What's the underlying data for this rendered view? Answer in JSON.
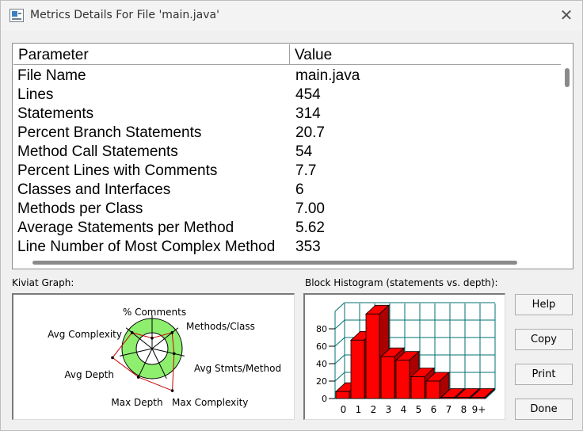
{
  "window": {
    "title": "Metrics Details For File 'main.java'",
    "close_glyph": "✕"
  },
  "table": {
    "headers": [
      "Parameter",
      "Value"
    ],
    "rows": [
      {
        "param": "File Name",
        "value": "main.java"
      },
      {
        "param": "Lines",
        "value": "454"
      },
      {
        "param": "Statements",
        "value": "314"
      },
      {
        "param": "Percent Branch Statements",
        "value": "20.7"
      },
      {
        "param": "Method Call Statements",
        "value": "54"
      },
      {
        "param": "Percent Lines with Comments",
        "value": "7.7"
      },
      {
        "param": "Classes and Interfaces",
        "value": "6"
      },
      {
        "param": "Methods per Class",
        "value": "7.00"
      },
      {
        "param": "Average Statements per Method",
        "value": "5.62"
      },
      {
        "param": "Line Number of Most Complex Method",
        "value": "353"
      }
    ]
  },
  "kiviat": {
    "label": "Kiviat Graph:",
    "axes": [
      "% Comments",
      "Methods/Class",
      "Avg Stmts/Method",
      "Max Complexity",
      "Max Depth",
      "Avg Depth",
      "Avg Complexity"
    ],
    "colors": {
      "band": "#8eee6e",
      "center": "#ffffff",
      "outline": "#000000",
      "polygon": "#cc0000"
    }
  },
  "histogram": {
    "label": "Block Histogram (statements vs. depth):",
    "colors": {
      "bar": "#ff0000",
      "bar_side": "#aa0000",
      "grid": "#007070"
    }
  },
  "chart_data": {
    "type": "bar",
    "categories": [
      "0",
      "1",
      "2",
      "3",
      "4",
      "5",
      "6",
      "7",
      "8",
      "9+"
    ],
    "values": [
      8,
      67,
      97,
      48,
      44,
      25,
      20,
      1,
      1,
      1
    ],
    "title": "Block Histogram (statements vs. depth):",
    "xlabel": "",
    "ylabel": "",
    "ylim": [
      0,
      100
    ],
    "yticks": [
      "0",
      "20",
      "40",
      "60",
      "80"
    ],
    "grid": true
  },
  "buttons": {
    "help": "Help",
    "copy": "Copy",
    "print": "Print",
    "done": "Done"
  }
}
